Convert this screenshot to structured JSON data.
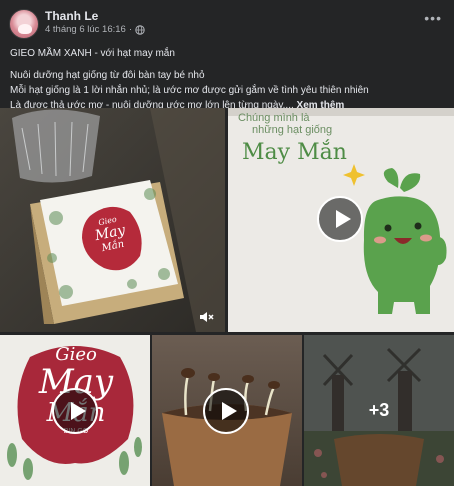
{
  "post": {
    "author": "Thanh Le",
    "timestamp": "4 tháng 6 lúc 16:16",
    "audience_icon": "globe-icon",
    "menu_icon": "more-horizontal-icon",
    "caption": {
      "title": "GIEO MẦM XANH - với hạt may mắn",
      "line1": "Nuôi dưỡng hạt giống từ đôi bàn tay bé nhỏ",
      "line2": "Mỗi hạt giống là 1 lời nhắn nhủ; là ước mơ được gửi gắm về tình yêu thiên nhiên",
      "line3": "Là được thả ước mơ - nuôi dưỡng ước mơ lớn lên từng ngày.... ",
      "see_more": "Xem thêm"
    }
  },
  "media": {
    "box_text": {
      "top": "Gieo",
      "middle": "May",
      "bottom": "Mắn"
    },
    "card_text": {
      "line1": "Chúng mình là",
      "line2": "những hạt giống",
      "brand": "May Mắn"
    },
    "logo_text": {
      "top": "Gieo",
      "middle": "May",
      "bottom": "Mắn",
      "small": "BIN GO"
    },
    "more_count": "+3",
    "icons": {
      "play": "play-icon",
      "mute": "muted-speaker-icon"
    }
  }
}
